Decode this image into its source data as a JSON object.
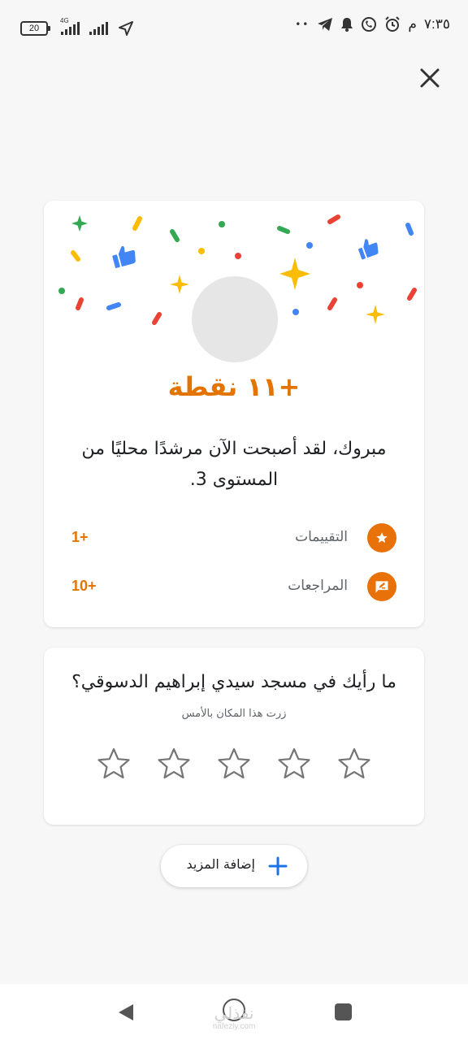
{
  "status_bar": {
    "time": "٧:٣٥",
    "ampm": "م",
    "battery": "20",
    "network_type": "4G",
    "overflow_dots": "••"
  },
  "result_card": {
    "points": "+١١ نقطة",
    "message": "مبروك، لقد أصبحت الآن مرشدًا محليًا من المستوى 3.",
    "stats": [
      {
        "label": "التقييمات",
        "value": "1+",
        "icon": "star-icon"
      },
      {
        "label": "المراجعات",
        "value": "10+",
        "icon": "review-icon"
      }
    ]
  },
  "rating_card": {
    "question": "ما رأيك في مسجد سيدي إبراهيم الدسوقي؟",
    "subtitle": "زرت هذا المكان بالأمس",
    "star_count": 5
  },
  "add_more": {
    "label": "إضافة المزيد"
  },
  "watermark": {
    "arabic": "نفذلي",
    "latin": "nafezly.com"
  },
  "colors": {
    "accent": "#e37400",
    "icon_bg": "#e8710a",
    "link_blue": "#1a73e8"
  }
}
